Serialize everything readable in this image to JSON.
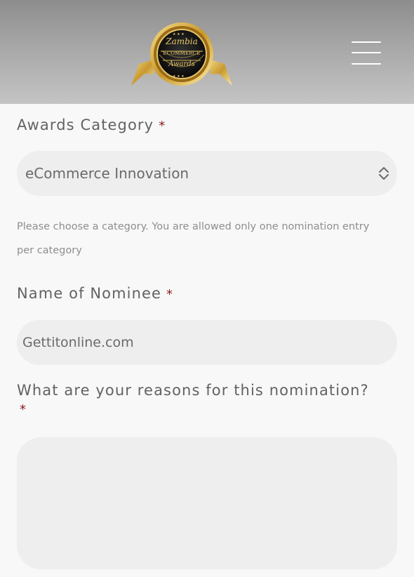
{
  "header": {
    "logo": {
      "text_line1": "Zambia",
      "text_line2": "ECOMMERCE",
      "text_line3": "Awards",
      "icon": "award-seal-icon"
    },
    "menu_icon": "hamburger-menu-icon"
  },
  "form": {
    "category": {
      "label": "Awards Category",
      "required_mark": "*",
      "selected_value": "eCommerce Innovation",
      "helper_text": "Please choose a category. You are allowed only one nomination entry per category"
    },
    "nominee": {
      "label": "Name of Nominee",
      "required_mark": "*",
      "value": "Gettitonline.com"
    },
    "reasons": {
      "label": "What are your reasons for this nomination?",
      "required_mark": "*",
      "value": ""
    }
  },
  "colors": {
    "required": "#8b1c1c",
    "field_bg": "#eeeeee",
    "page_bg": "#f8f8f8",
    "header_gold": "#d8a83d"
  }
}
